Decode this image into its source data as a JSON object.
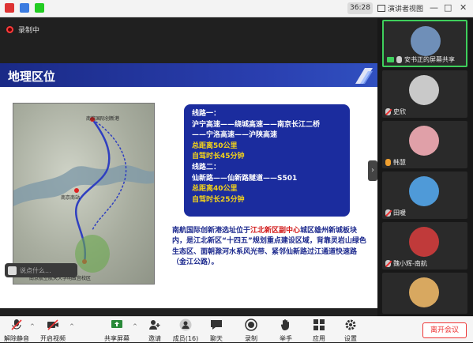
{
  "titlebar": {
    "timer": "36:28",
    "view_label": "演讲者视图",
    "window_buttons": [
      "—",
      "□",
      "✕"
    ]
  },
  "recording": {
    "label": "录制中"
  },
  "slide": {
    "title": "地理区位",
    "routes": [
      {
        "text": "线路一：",
        "color": "white"
      },
      {
        "text": "沪宁高速——绕城高速——南京长江二桥",
        "color": "white"
      },
      {
        "text": "——宁洛高速——沪陕高速",
        "color": "white"
      },
      {
        "text": "总距离50公里",
        "color": "yellow"
      },
      {
        "text": "自驾时长45分钟",
        "color": "yellow"
      },
      {
        "text": "线路二：",
        "color": "white"
      },
      {
        "text": "仙新路——仙新路隧道——S501",
        "color": "white"
      },
      {
        "text": "总距离40公里",
        "color": "yellow"
      },
      {
        "text": "自驾时长25分钟",
        "color": "yellow"
      }
    ],
    "desc_part1": "南航国际创新港选址位于",
    "desc_highlight": "江北新区副中心",
    "desc_part2": "城区雄州新城板块内，是江北新区“十四五”规划重点建设区域，背靠灵岩山绿色生态区、面朝滁河水系风光带、紧邻仙新路过江通道快速路（金江公路）。",
    "map_labels": [
      "南航国际创新港",
      "南京南站",
      "南京航空航天大学明故宫校区"
    ]
  },
  "chat": {
    "placeholder": "说点什么..."
  },
  "participants": [
    {
      "name": "安书正的屏幕共享",
      "sharing": true,
      "avatar_color": "#6f8fb8",
      "muted": false
    },
    {
      "name": "史欣",
      "sharing": false,
      "avatar_color": "#c9c9c9",
      "muted": true
    },
    {
      "name": "韩慧",
      "sharing": false,
      "avatar_color": "#e0a0a8",
      "muted": false
    },
    {
      "name": "田暖",
      "sharing": false,
      "avatar_color": "#4f9ad8",
      "muted": true
    },
    {
      "name": "魏小辉-南航",
      "sharing": false,
      "avatar_color": "#c03a3a",
      "muted": true
    },
    {
      "name": "",
      "sharing": false,
      "avatar_color": "#d8a860",
      "muted": false
    }
  ],
  "toolbar": {
    "mute": "解除静音",
    "video": "开启视频",
    "share": "共享屏幕",
    "invite": "邀请",
    "members": "成员(16)",
    "chat": "聊天",
    "record": "录制",
    "hand": "举手",
    "apps": "应用",
    "settings": "设置",
    "leave": "离开会议"
  },
  "colors": {
    "slide_blue": "#1b2c9e",
    "route_yellow": "#f3d21a",
    "highlight_red": "#d21a1a",
    "active_green": "#3ecf5c"
  }
}
